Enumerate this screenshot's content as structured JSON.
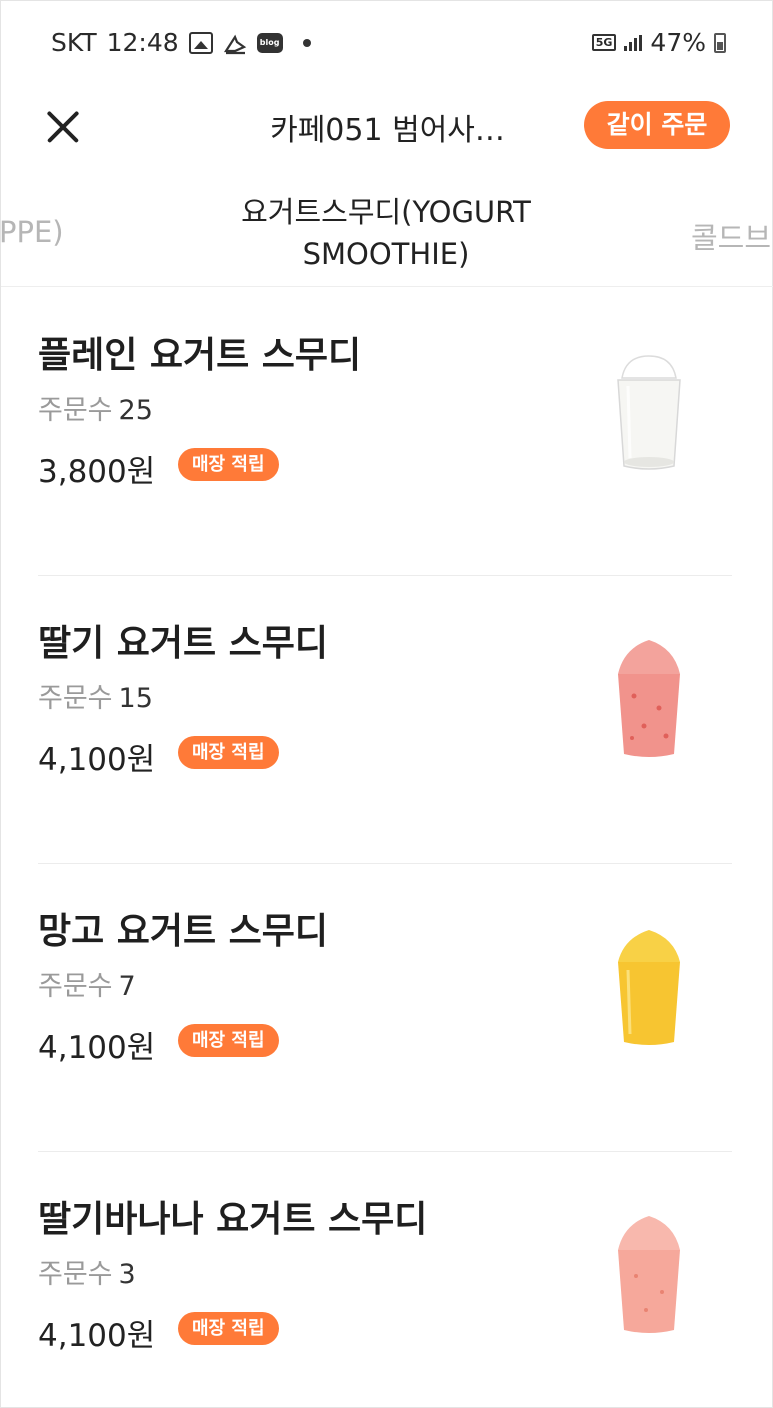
{
  "status_bar": {
    "carrier": "SKT",
    "time": "12:48",
    "network": "5G",
    "battery": "47%",
    "icons": [
      "gallery-icon",
      "app-icon",
      "blog-icon",
      "notification-dot-icon"
    ]
  },
  "header": {
    "close_icon": "close-icon",
    "store_name": "카페051 범어사…",
    "group_order_label": "같이 주문"
  },
  "tabs": {
    "prev": "PPE)",
    "active": "요거트스무디(YOGURT SMOOTHIE)",
    "next": "콜드브"
  },
  "menu": {
    "orders_label": "주문수",
    "items": [
      {
        "name": "플레인 요거트 스무디",
        "orders": "25",
        "price": "3,800원",
        "badge": "매장 적립",
        "color": "#f6f6f3"
      },
      {
        "name": "딸기 요거트 스무디",
        "orders": "15",
        "price": "4,100원",
        "badge": "매장 적립",
        "color": "#f1938c"
      },
      {
        "name": "망고 요거트 스무디",
        "orders": "7",
        "price": "4,100원",
        "badge": "매장 적립",
        "color": "#f7c531"
      },
      {
        "name": "딸기바나나 요거트 스무디",
        "orders": "3",
        "price": "4,100원",
        "badge": "매장 적립",
        "color": "#f6a89b"
      }
    ]
  },
  "colors": {
    "accent": "#ff7a38",
    "muted_text": "#9a9a9a",
    "divider": "#ececec"
  }
}
